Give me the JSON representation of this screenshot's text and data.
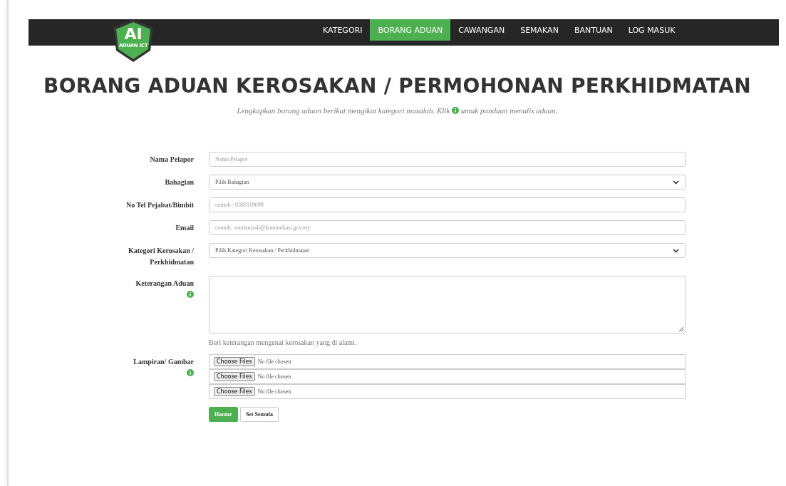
{
  "logo": {
    "initials": "AI",
    "caption": "ADUAN ICT"
  },
  "nav": [
    {
      "label": "KATEGORI",
      "selected": false
    },
    {
      "label": "BORANG ADUAN",
      "selected": true
    },
    {
      "label": "CAWANGAN",
      "selected": false
    },
    {
      "label": "SEMAKAN",
      "selected": false
    },
    {
      "label": "BANTUAN",
      "selected": false
    },
    {
      "label": "LOG MASUK",
      "selected": false
    }
  ],
  "title": "BORANG ADUAN KEROSAKAN / PERMOHONAN PERKHIDMATAN",
  "subtitle_before": "Lengkapkan borang aduan berikut mengikut kategori masalah. Klik",
  "subtitle_after": "untuk panduan menulis aduan.",
  "fields": [
    {
      "kind": "text",
      "label": "Nama Pelapor",
      "info": false,
      "placeholder": "Nama Pelapor"
    },
    {
      "kind": "select",
      "label": "Bahagian",
      "info": false,
      "value": "Pilih Bahagian"
    },
    {
      "kind": "text",
      "label": "No Tel Pejabat/Bimbit",
      "info": false,
      "placeholder": "contoh : 0389118098"
    },
    {
      "kind": "text",
      "label": "Email",
      "info": false,
      "placeholder": "contoh: wanfauziah@komunikasi.gov.my"
    },
    {
      "kind": "select",
      "label": "Kategori Kerosakan / Perkhidmatan",
      "info": false,
      "value": "Pilih Kategori Kerosakan / Perkhidmatan"
    },
    {
      "kind": "textarea",
      "label": "Keterangan Aduan",
      "info": true,
      "help": "Beri keterangan mengenai kerosakan yang di alami."
    },
    {
      "kind": "file",
      "label": "Lampiran/ Gambar",
      "info": true,
      "inputs": [
        {
          "button": "Choose Files",
          "status": "No file chosen"
        },
        {
          "button": "Choose Files",
          "status": "No file chosen"
        },
        {
          "button": "Choose Files",
          "status": "No file chosen"
        }
      ]
    }
  ],
  "buttons": [
    {
      "label": "Hantar",
      "kind": "primary"
    },
    {
      "label": "Set Semula",
      "kind": "default"
    }
  ]
}
